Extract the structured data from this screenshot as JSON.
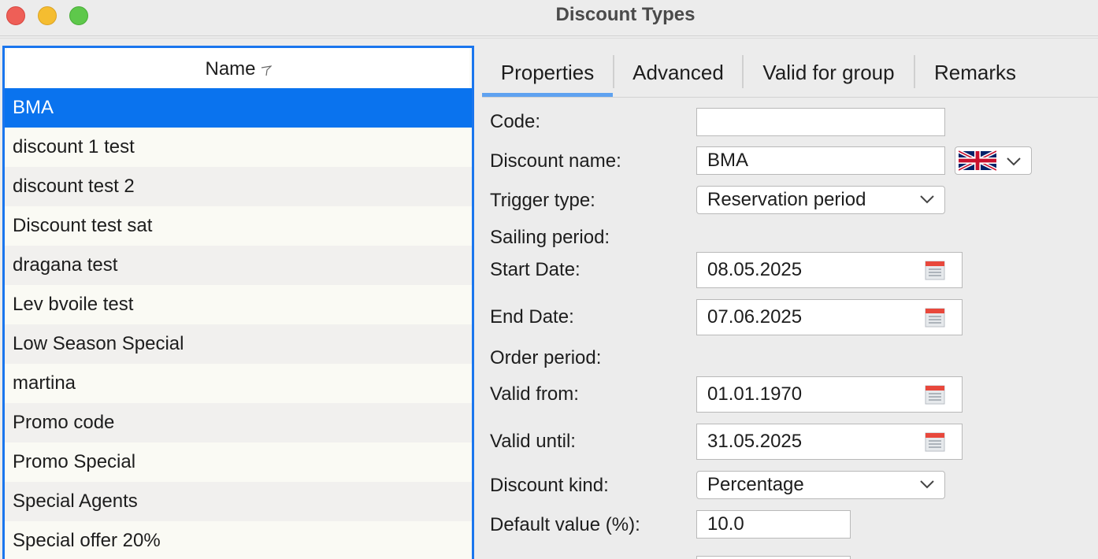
{
  "window": {
    "title": "Discount Types"
  },
  "list": {
    "header": "Name",
    "rows": [
      "BMA",
      "discount 1 test",
      "discount test 2",
      "Discount test sat",
      "dragana test",
      "Lev bvoile test",
      "Low Season Special",
      "martina",
      "Promo code",
      "Promo Special",
      "Special Agents",
      "Special offer 20%"
    ],
    "selected_index": 0
  },
  "tabs": [
    "Properties",
    "Advanced",
    "Valid for group",
    "Remarks"
  ],
  "active_tab": "Properties",
  "form": {
    "code_label": "Code:",
    "code_value": "",
    "discount_name_label": "Discount name:",
    "discount_name_value": "BMA",
    "language_icon": "uk-flag-icon",
    "trigger_type_label": "Trigger type:",
    "trigger_type_value": "Reservation period",
    "sailing_period_label": "Sailing period:",
    "start_date_label": "Start Date:",
    "start_date_value": "08.05.2025",
    "end_date_label": "End Date:",
    "end_date_value": "07.06.2025",
    "order_period_label": "Order period:",
    "valid_from_label": "Valid from:",
    "valid_from_value": "01.01.1970",
    "valid_until_label": "Valid until:",
    "valid_until_value": "31.05.2025",
    "discount_kind_label": "Discount kind:",
    "discount_kind_value": "Percentage",
    "default_value_label": "Default value (%):",
    "default_value_value": "10.0"
  },
  "colors": {
    "selection": "#0a73ee",
    "focus_border": "#1a76ee",
    "tab_underline": "#5fa2f0"
  }
}
